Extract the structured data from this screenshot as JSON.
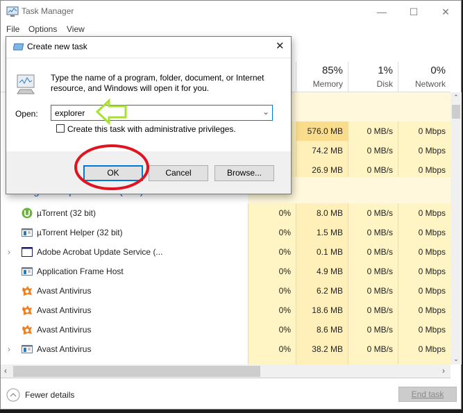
{
  "window": {
    "title": "Task Manager",
    "minimize": "—",
    "maximize": "☐",
    "close": "✕"
  },
  "menu": [
    "File",
    "Options",
    "View"
  ],
  "columns": [
    {
      "pct": "85%",
      "label": "Memory"
    },
    {
      "pct": "1%",
      "label": "Disk"
    },
    {
      "pct": "0%",
      "label": "Network"
    }
  ],
  "app_rows": [
    {
      "memory": "576.0 MB",
      "disk": "0 MB/s",
      "network": "0 Mbps"
    },
    {
      "memory": "74.2 MB",
      "disk": "0 MB/s",
      "network": "0 Mbps"
    },
    {
      "memory": "26.9 MB",
      "disk": "0 MB/s",
      "network": "0 Mbps"
    }
  ],
  "group_header": "Background processes (124)",
  "bg_rows": [
    {
      "name": "µTorrent (32 bit)",
      "icon": "utorrent-icon",
      "expand": false,
      "cpu": "0%",
      "memory": "8.0 MB",
      "disk": "0 MB/s",
      "network": "0 Mbps"
    },
    {
      "name": "µTorrent Helper (32 bit)",
      "icon": "app-window-icon",
      "expand": false,
      "cpu": "0%",
      "memory": "1.5 MB",
      "disk": "0 MB/s",
      "network": "0 Mbps"
    },
    {
      "name": "Adobe Acrobat Update Service (...",
      "icon": "service-window-icon",
      "expand": true,
      "cpu": "0%",
      "memory": "0.1 MB",
      "disk": "0 MB/s",
      "network": "0 Mbps"
    },
    {
      "name": "Application Frame Host",
      "icon": "app-window-icon",
      "expand": false,
      "cpu": "0%",
      "memory": "4.9 MB",
      "disk": "0 MB/s",
      "network": "0 Mbps"
    },
    {
      "name": "Avast Antivirus",
      "icon": "avast-icon",
      "expand": false,
      "cpu": "0%",
      "memory": "6.2 MB",
      "disk": "0 MB/s",
      "network": "0 Mbps"
    },
    {
      "name": "Avast Antivirus",
      "icon": "avast-icon",
      "expand": false,
      "cpu": "0%",
      "memory": "18.6 MB",
      "disk": "0 MB/s",
      "network": "0 Mbps"
    },
    {
      "name": "Avast Antivirus",
      "icon": "avast-icon",
      "expand": false,
      "cpu": "0%",
      "memory": "8.6 MB",
      "disk": "0 MB/s",
      "network": "0 Mbps"
    },
    {
      "name": "Avast Antivirus",
      "icon": "app-window-icon",
      "expand": true,
      "cpu": "0%",
      "memory": "38.2 MB",
      "disk": "0 MB/s",
      "network": "0 Mbps"
    }
  ],
  "footer": {
    "fewer_details": "Fewer details",
    "end_task": "End task"
  },
  "dialog": {
    "title": "Create new task",
    "description": "Type the name of a program, folder, document, or Internet resource, and Windows will open it for you.",
    "open_label": "Open:",
    "open_value": "explorer",
    "admin_checkbox": "Create this task with administrative privileges.",
    "admin_checked": false,
    "ok": "OK",
    "cancel": "Cancel",
    "browse": "Browse..."
  },
  "annotations": {
    "arrow_color": "#a6e22e",
    "circle_color": "#e0141e"
  },
  "colors": {
    "cpu_bg": "#fff4c4",
    "mem_bg": "#ffefb8",
    "mem_hot": "#f9dc8c",
    "accent": "#0078d7"
  }
}
